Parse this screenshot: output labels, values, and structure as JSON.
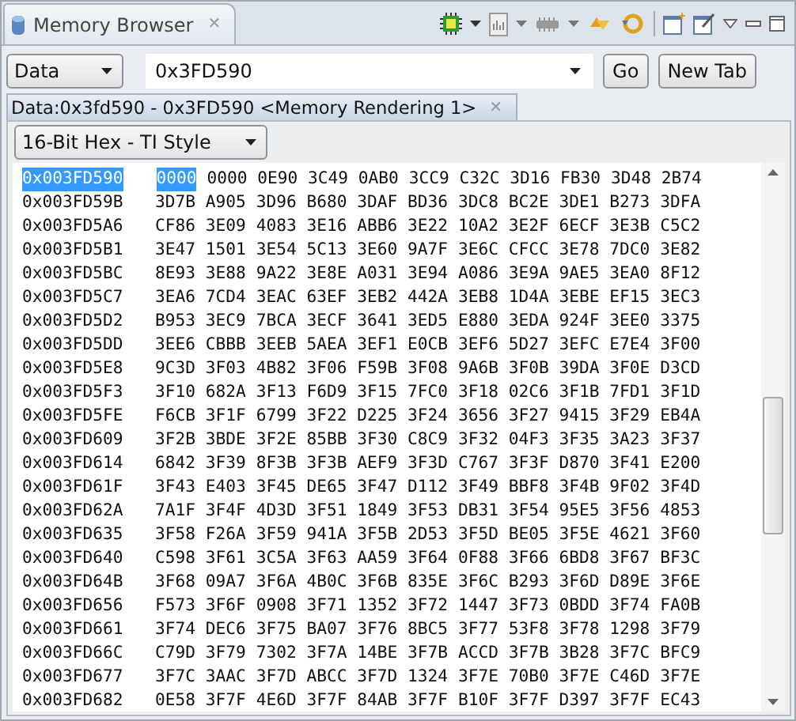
{
  "view_tab": {
    "title": "Memory Browser",
    "close": "✕"
  },
  "toolbar": {
    "memory_space": "Data",
    "address": "0x3FD590",
    "go": "Go",
    "new_tab": "New Tab"
  },
  "rendering_tab": {
    "title": "Data:0x3fd590 - 0x3FD590 <Memory Rendering 1>",
    "close": "✕"
  },
  "format": "16-Bit Hex - TI Style",
  "rows": [
    {
      "address": "0x003FD590",
      "selected": true,
      "words": [
        "0000",
        "0000",
        "0E90",
        "3C49",
        "0AB0",
        "3CC9",
        "C32C",
        "3D16",
        "FB30",
        "3D48",
        "2B74"
      ]
    },
    {
      "address": "0x003FD59B",
      "selected": false,
      "words": [
        "3D7B",
        "A905",
        "3D96",
        "B680",
        "3DAF",
        "BD36",
        "3DC8",
        "BC2E",
        "3DE1",
        "B273",
        "3DFA"
      ]
    },
    {
      "address": "0x003FD5A6",
      "selected": false,
      "words": [
        "CF86",
        "3E09",
        "4083",
        "3E16",
        "ABB6",
        "3E22",
        "10A2",
        "3E2F",
        "6ECF",
        "3E3B",
        "C5C2"
      ]
    },
    {
      "address": "0x003FD5B1",
      "selected": false,
      "words": [
        "3E47",
        "1501",
        "3E54",
        "5C13",
        "3E60",
        "9A7F",
        "3E6C",
        "CFCC",
        "3E78",
        "7DC0",
        "3E82"
      ]
    },
    {
      "address": "0x003FD5BC",
      "selected": false,
      "words": [
        "8E93",
        "3E88",
        "9A22",
        "3E8E",
        "A031",
        "3E94",
        "A086",
        "3E9A",
        "9AE5",
        "3EA0",
        "8F12"
      ]
    },
    {
      "address": "0x003FD5C7",
      "selected": false,
      "words": [
        "3EA6",
        "7CD4",
        "3EAC",
        "63EF",
        "3EB2",
        "442A",
        "3EB8",
        "1D4A",
        "3EBE",
        "EF15",
        "3EC3"
      ]
    },
    {
      "address": "0x003FD5D2",
      "selected": false,
      "words": [
        "B953",
        "3EC9",
        "7BCA",
        "3ECF",
        "3641",
        "3ED5",
        "E880",
        "3EDA",
        "924F",
        "3EE0",
        "3375"
      ]
    },
    {
      "address": "0x003FD5DD",
      "selected": false,
      "words": [
        "3EE6",
        "CBBB",
        "3EEB",
        "5AEA",
        "3EF1",
        "E0CB",
        "3EF6",
        "5D27",
        "3EFC",
        "E7E4",
        "3F00"
      ]
    },
    {
      "address": "0x003FD5E8",
      "selected": false,
      "words": [
        "9C3D",
        "3F03",
        "4B82",
        "3F06",
        "F59B",
        "3F08",
        "9A6B",
        "3F0B",
        "39DA",
        "3F0E",
        "D3CD"
      ]
    },
    {
      "address": "0x003FD5F3",
      "selected": false,
      "words": [
        "3F10",
        "682A",
        "3F13",
        "F6D9",
        "3F15",
        "7FC0",
        "3F18",
        "02C6",
        "3F1B",
        "7FD1",
        "3F1D"
      ]
    },
    {
      "address": "0x003FD5FE",
      "selected": false,
      "words": [
        "F6CB",
        "3F1F",
        "6799",
        "3F22",
        "D225",
        "3F24",
        "3656",
        "3F27",
        "9415",
        "3F29",
        "EB4A"
      ]
    },
    {
      "address": "0x003FD609",
      "selected": false,
      "words": [
        "3F2B",
        "3BDE",
        "3F2E",
        "85BB",
        "3F30",
        "C8C9",
        "3F32",
        "04F3",
        "3F35",
        "3A23",
        "3F37"
      ]
    },
    {
      "address": "0x003FD614",
      "selected": false,
      "words": [
        "6842",
        "3F39",
        "8F3B",
        "3F3B",
        "AEF9",
        "3F3D",
        "C767",
        "3F3F",
        "D870",
        "3F41",
        "E200"
      ]
    },
    {
      "address": "0x003FD61F",
      "selected": false,
      "words": [
        "3F43",
        "E403",
        "3F45",
        "DE65",
        "3F47",
        "D112",
        "3F49",
        "BBF8",
        "3F4B",
        "9F02",
        "3F4D"
      ]
    },
    {
      "address": "0x003FD62A",
      "selected": false,
      "words": [
        "7A1F",
        "3F4F",
        "4D3D",
        "3F51",
        "1849",
        "3F53",
        "DB31",
        "3F54",
        "95E5",
        "3F56",
        "4853"
      ]
    },
    {
      "address": "0x003FD635",
      "selected": false,
      "words": [
        "3F58",
        "F26A",
        "3F59",
        "941A",
        "3F5B",
        "2D53",
        "3F5D",
        "BE05",
        "3F5E",
        "4621",
        "3F60"
      ]
    },
    {
      "address": "0x003FD640",
      "selected": false,
      "words": [
        "C598",
        "3F61",
        "3C5A",
        "3F63",
        "AA59",
        "3F64",
        "0F88",
        "3F66",
        "6BD8",
        "3F67",
        "BF3C"
      ]
    },
    {
      "address": "0x003FD64B",
      "selected": false,
      "words": [
        "3F68",
        "09A7",
        "3F6A",
        "4B0C",
        "3F6B",
        "835E",
        "3F6C",
        "B293",
        "3F6D",
        "D89E",
        "3F6E"
      ]
    },
    {
      "address": "0x003FD656",
      "selected": false,
      "words": [
        "F573",
        "3F6F",
        "0908",
        "3F71",
        "1352",
        "3F72",
        "1447",
        "3F73",
        "0BDD",
        "3F74",
        "FA0B"
      ]
    },
    {
      "address": "0x003FD661",
      "selected": false,
      "words": [
        "3F74",
        "DEC6",
        "3F75",
        "BA07",
        "3F76",
        "8BC5",
        "3F77",
        "53F8",
        "3F78",
        "1298",
        "3F79"
      ]
    },
    {
      "address": "0x003FD66C",
      "selected": false,
      "words": [
        "C79D",
        "3F79",
        "7302",
        "3F7A",
        "14BE",
        "3F7B",
        "ACCD",
        "3F7B",
        "3B28",
        "3F7C",
        "BFC9"
      ]
    },
    {
      "address": "0x003FD677",
      "selected": false,
      "words": [
        "3F7C",
        "3AAC",
        "3F7D",
        "ABCC",
        "3F7D",
        "1324",
        "3F7E",
        "70B0",
        "3F7E",
        "C46D",
        "3F7E"
      ]
    },
    {
      "address": "0x003FD682",
      "selected": false,
      "words": [
        "0E58",
        "3F7F",
        "4E6D",
        "3F7F",
        "84AB",
        "3F7F",
        "B10F",
        "3F7F",
        "D397",
        "3F7F",
        "EC43"
      ]
    }
  ]
}
